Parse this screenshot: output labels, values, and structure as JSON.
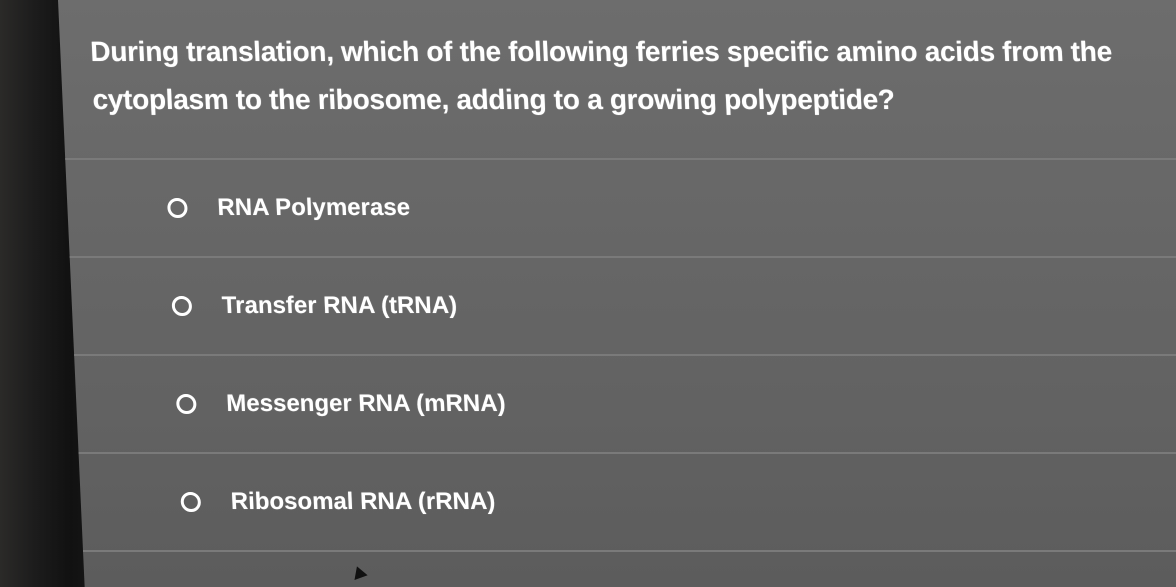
{
  "question": {
    "line1": "During translation, which of the following ferries specific amino acids from the",
    "line2": "cytoplasm to the ribosome, adding to a growing polypeptide?"
  },
  "options": [
    {
      "label": "RNA Polymerase",
      "selected": false
    },
    {
      "label": "Transfer RNA (tRNA)",
      "selected": false
    },
    {
      "label": "Messenger RNA (mRNA)",
      "selected": false
    },
    {
      "label": "Ribosomal RNA (rRNA)",
      "selected": false
    }
  ],
  "icons": {
    "radio": "radio-unselected-icon",
    "cursor": "mouse-pointer-icon"
  },
  "colors": {
    "background": "#666666",
    "text": "#ffffff",
    "divider": "#7a7a7a"
  }
}
